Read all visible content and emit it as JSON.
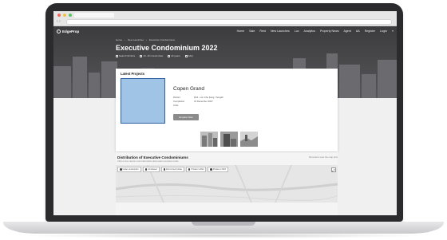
{
  "site": {
    "logo_text": "EdgeProp",
    "nav": [
      "Home",
      "Sale",
      "Rent",
      "New Launches",
      "Lux",
      "Analytics",
      "Property News",
      "Agent",
      "AA",
      "Register",
      "Login"
    ]
  },
  "hero": {
    "breadcrumb": [
      "Home",
      "New Launches",
      "Executive Condominium"
    ],
    "title": "Executive Condominium 2022",
    "meta": [
      "Search 62 ECs",
      "10 -15 Condo New",
      "20 years",
      "FAQ"
    ]
  },
  "latest": {
    "heading": "Latest Projects",
    "project_name": "Copen Grand",
    "details": [
      {
        "key": "District",
        "value": "D24 - Lim Chu Kang / Tengah"
      },
      {
        "key": "Completion",
        "value": "31 December 2027"
      },
      {
        "key": "Units",
        "value": ""
      }
    ],
    "button": "Enquire Now"
  },
  "distribution": {
    "title": "Distribution of Executive Condominiums",
    "subtitle": "Click on the map for more information about each executive condo",
    "link": "Show ECs near the map pins",
    "filters": [
      "Under construction",
      "Completed",
      "ECs turned private",
      "Private in 2022",
      "Private in 2023"
    ],
    "expand_icon": "expand-icon"
  },
  "colors": {
    "hero_bg": "#3c3c3e",
    "thumb_fill": "#9fc4e5",
    "thumb_border": "#2e5fa3",
    "button_bg": "#8a8a8a"
  }
}
